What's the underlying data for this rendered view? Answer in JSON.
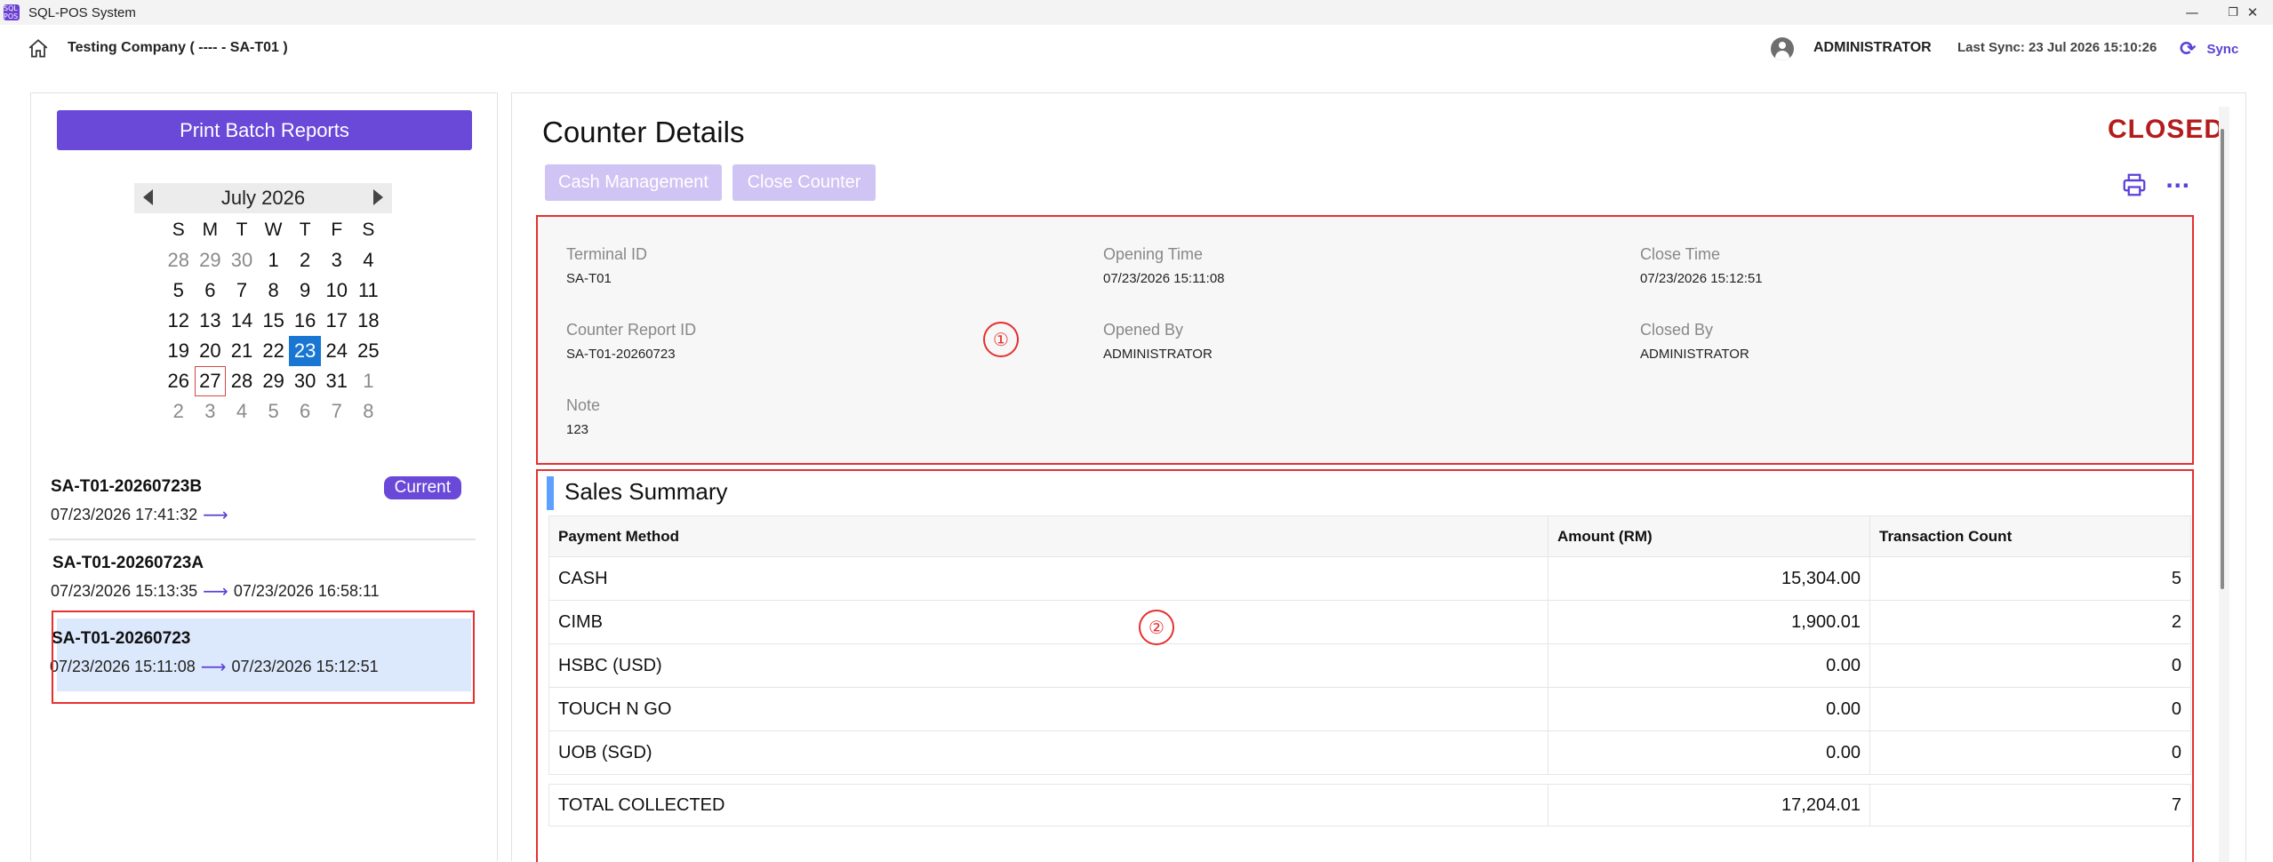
{
  "window": {
    "title": "SQL-POS System",
    "icon_text": "SQL POS",
    "controls": [
      "—",
      "❐",
      "✕"
    ]
  },
  "header": {
    "company": "Testing Company ( ---- - SA-T01 )",
    "user": "ADMINISTRATOR",
    "last_sync": "Last Sync: 23 Jul 2026 15:10:26",
    "sync_label": "Sync"
  },
  "left": {
    "print_batch_label": "Print Batch Reports",
    "calendar": {
      "month_label": "July 2026",
      "weekdays": [
        "S",
        "M",
        "T",
        "W",
        "T",
        "F",
        "S"
      ],
      "weeks": [
        [
          {
            "d": "28",
            "o": true
          },
          {
            "d": "29",
            "o": true
          },
          {
            "d": "30",
            "o": true
          },
          {
            "d": "1"
          },
          {
            "d": "2"
          },
          {
            "d": "3"
          },
          {
            "d": "4"
          }
        ],
        [
          {
            "d": "5"
          },
          {
            "d": "6"
          },
          {
            "d": "7"
          },
          {
            "d": "8"
          },
          {
            "d": "9"
          },
          {
            "d": "10"
          },
          {
            "d": "11"
          }
        ],
        [
          {
            "d": "12"
          },
          {
            "d": "13"
          },
          {
            "d": "14"
          },
          {
            "d": "15"
          },
          {
            "d": "16"
          },
          {
            "d": "17"
          },
          {
            "d": "18"
          }
        ],
        [
          {
            "d": "19"
          },
          {
            "d": "20"
          },
          {
            "d": "21"
          },
          {
            "d": "22"
          },
          {
            "d": "23",
            "sel": true
          },
          {
            "d": "24"
          },
          {
            "d": "25"
          }
        ],
        [
          {
            "d": "26"
          },
          {
            "d": "27",
            "today": true
          },
          {
            "d": "28"
          },
          {
            "d": "29"
          },
          {
            "d": "30"
          },
          {
            "d": "31"
          },
          {
            "d": "1",
            "o": true
          }
        ],
        [
          {
            "d": "2",
            "o": true
          },
          {
            "d": "3",
            "o": true
          },
          {
            "d": "4",
            "o": true
          },
          {
            "d": "5",
            "o": true
          },
          {
            "d": "6",
            "o": true
          },
          {
            "d": "7",
            "o": true
          },
          {
            "d": "8",
            "o": true
          }
        ]
      ]
    },
    "reports": [
      {
        "id": "SA-T01-20260723B",
        "start": "07/23/2026 17:41:32",
        "end": "",
        "badge": "Current"
      },
      {
        "id": "SA-T01-20260723A",
        "start": "07/23/2026 15:13:35",
        "end": "07/23/2026 16:58:11",
        "badge": ""
      },
      {
        "id": "SA-T01-20260723",
        "start": "07/23/2026 15:11:08",
        "end": "07/23/2026 15:12:51",
        "badge": ""
      }
    ]
  },
  "main": {
    "title": "Counter Details",
    "status": "CLOSED",
    "cash_management_label": "Cash Management",
    "close_counter_label": "Close Counter",
    "info": {
      "terminal_id_label": "Terminal ID",
      "terminal_id": "SA-T01",
      "opening_time_label": "Opening Time",
      "opening_time": "07/23/2026 15:11:08",
      "close_time_label": "Close Time",
      "close_time": "07/23/2026 15:12:51",
      "counter_report_id_label": "Counter Report ID",
      "counter_report_id": "SA-T01-20260723",
      "opened_by_label": "Opened By",
      "opened_by": "ADMINISTRATOR",
      "closed_by_label": "Closed By",
      "closed_by": "ADMINISTRATOR",
      "note_label": "Note",
      "note": "123"
    },
    "annotations": [
      "①",
      "②"
    ],
    "sales_summary": {
      "title": "Sales Summary",
      "columns": [
        "Payment Method",
        "Amount (RM)",
        "Transaction Count"
      ],
      "rows": [
        {
          "method": "CASH",
          "amount": "15,304.00",
          "count": "5"
        },
        {
          "method": "CIMB",
          "amount": "1,900.01",
          "count": "2"
        },
        {
          "method": "HSBC (USD)",
          "amount": "0.00",
          "count": "0"
        },
        {
          "method": "TOUCH N GO",
          "amount": "0.00",
          "count": "0"
        },
        {
          "method": "UOB (SGD)",
          "amount": "0.00",
          "count": "0"
        }
      ],
      "total": {
        "method": "TOTAL COLLECTED",
        "amount": "17,204.01",
        "count": "7"
      }
    }
  }
}
